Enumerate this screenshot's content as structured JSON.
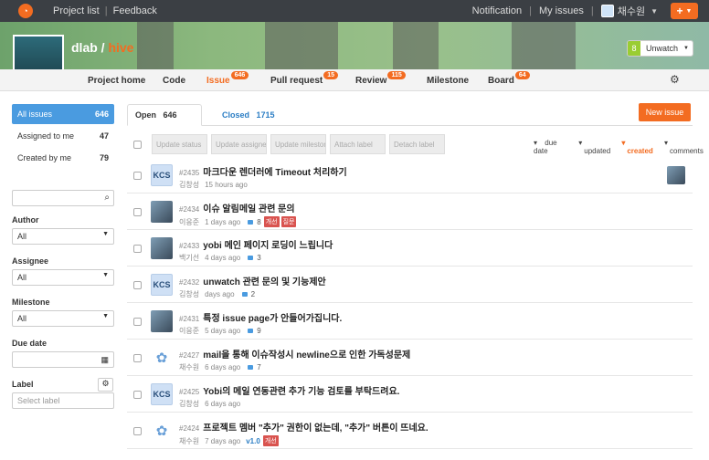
{
  "topbar": {
    "project_list": "Project list",
    "feedback": "Feedback",
    "notification": "Notification",
    "my_issues": "My issues",
    "user": "채수원",
    "plus": "+"
  },
  "project": {
    "owner": "dlab",
    "separator": "/",
    "name": "hive",
    "watch_count": "8",
    "watch_label": "Unwatch"
  },
  "nav": [
    {
      "label": "Project home"
    },
    {
      "label": "Code"
    },
    {
      "label": "Issue",
      "badge": "646"
    },
    {
      "label": "Pull request",
      "badge": "15"
    },
    {
      "label": "Review",
      "badge": "115"
    },
    {
      "label": "Milestone"
    },
    {
      "label": "Board",
      "badge": "64"
    }
  ],
  "sidebar": {
    "items": [
      {
        "label": "All issues",
        "count": "646"
      },
      {
        "label": "Assigned to me",
        "count": "47"
      },
      {
        "label": "Created by me",
        "count": "79"
      }
    ],
    "filters": {
      "author": "Author",
      "author_value": "All",
      "assignee": "Assignee",
      "assignee_value": "All",
      "milestone": "Milestone",
      "milestone_value": "All",
      "due_date": "Due date",
      "label": "Label",
      "label_placeholder": "Select label"
    }
  },
  "tabs": {
    "open": "Open",
    "open_count": "646",
    "closed": "Closed",
    "closed_count": "1715",
    "new_issue": "New issue"
  },
  "toolbar": {
    "buttons": [
      "Update status",
      "Update assignee",
      "Update milestone",
      "Attach label",
      "Detach label"
    ],
    "sort": [
      "due date",
      "updated",
      "created",
      "comments"
    ]
  },
  "issues": [
    {
      "num": "#2435",
      "title": "마크다운 렌더러에 Timeout 처리하기",
      "author": "김창성",
      "time": "15 hours ago",
      "comments": "",
      "labels": [],
      "milestone": ""
    },
    {
      "num": "#2434",
      "title": "이슈 알림메일 관련 문의",
      "author": "이응준",
      "time": "1 days ago",
      "comments": "8",
      "labels": [
        "개선",
        "질문"
      ],
      "milestone": ""
    },
    {
      "num": "#2433",
      "title": "yobi 메인 페이지 로딩이 느립니다",
      "author": "백기선",
      "time": "4 days ago",
      "comments": "3",
      "labels": [],
      "milestone": ""
    },
    {
      "num": "#2432",
      "title": "unwatch 관련 문의 및 기능제안",
      "author": "김창성",
      "time": "days ago",
      "comments": "2",
      "labels": [],
      "milestone": ""
    },
    {
      "num": "#2431",
      "title": "특정 issue page가 안들어가집니다.",
      "author": "이응준",
      "time": "5 days ago",
      "comments": "9",
      "labels": [],
      "milestone": ""
    },
    {
      "num": "#2427",
      "title": "mail을 통해 이슈작성시 newline으로 인한 가독성문제",
      "author": "채수원",
      "time": "6 days ago",
      "comments": "7",
      "labels": [],
      "milestone": ""
    },
    {
      "num": "#2425",
      "title": "Yobi의 메일 연동관련 추가 기능 검토를 부탁드려요.",
      "author": "김창성",
      "time": "6 days ago",
      "comments": "",
      "labels": [],
      "milestone": ""
    },
    {
      "num": "#2424",
      "title": "프로젝트 멤버 \"추가\" 권한이 없는데, \"추가\" 버튼이 뜨네요.",
      "author": "채수원",
      "time": "7 days ago",
      "comments": "",
      "labels": [
        "개선"
      ],
      "milestone": "v1.0"
    }
  ],
  "avatars": {
    "kcs": "KCS",
    "doodle": "✿"
  },
  "colors": {
    "accent": "#f36c21",
    "link": "#2a7dc4",
    "topbar": "#3b3f44",
    "label": "#d9534f"
  }
}
